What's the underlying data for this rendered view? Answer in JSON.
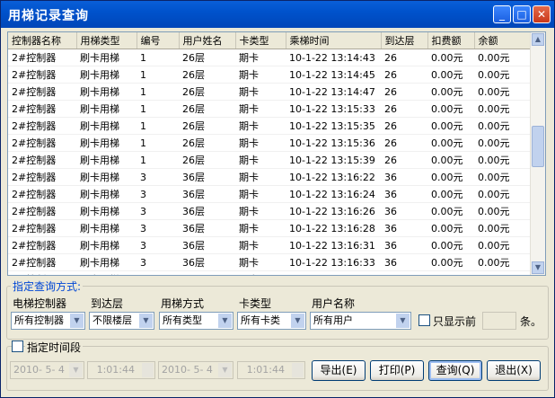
{
  "window": {
    "title": "用梯记录查询",
    "buttons": {
      "minimize": "_",
      "maximize": "□",
      "close": "✕"
    }
  },
  "table": {
    "columns": [
      "控制器名称",
      "用梯类型",
      "编号",
      "用户姓名",
      "卡类型",
      "乘梯时间",
      "到达层",
      "扣费额",
      "余额"
    ],
    "rows": [
      [
        "2#控制器",
        "刷卡用梯",
        "1",
        "26层",
        "期卡",
        "10-1-22 13:14:43",
        "26",
        "0.00元",
        "0.00元"
      ],
      [
        "2#控制器",
        "刷卡用梯",
        "1",
        "26层",
        "期卡",
        "10-1-22 13:14:45",
        "26",
        "0.00元",
        "0.00元"
      ],
      [
        "2#控制器",
        "刷卡用梯",
        "1",
        "26层",
        "期卡",
        "10-1-22 13:14:47",
        "26",
        "0.00元",
        "0.00元"
      ],
      [
        "2#控制器",
        "刷卡用梯",
        "1",
        "26层",
        "期卡",
        "10-1-22 13:15:33",
        "26",
        "0.00元",
        "0.00元"
      ],
      [
        "2#控制器",
        "刷卡用梯",
        "1",
        "26层",
        "期卡",
        "10-1-22 13:15:35",
        "26",
        "0.00元",
        "0.00元"
      ],
      [
        "2#控制器",
        "刷卡用梯",
        "1",
        "26层",
        "期卡",
        "10-1-22 13:15:36",
        "26",
        "0.00元",
        "0.00元"
      ],
      [
        "2#控制器",
        "刷卡用梯",
        "1",
        "26层",
        "期卡",
        "10-1-22 13:15:39",
        "26",
        "0.00元",
        "0.00元"
      ],
      [
        "2#控制器",
        "刷卡用梯",
        "3",
        "36层",
        "期卡",
        "10-1-22 13:16:22",
        "36",
        "0.00元",
        "0.00元"
      ],
      [
        "2#控制器",
        "刷卡用梯",
        "3",
        "36层",
        "期卡",
        "10-1-22 13:16:24",
        "36",
        "0.00元",
        "0.00元"
      ],
      [
        "2#控制器",
        "刷卡用梯",
        "3",
        "36层",
        "期卡",
        "10-1-22 13:16:26",
        "36",
        "0.00元",
        "0.00元"
      ],
      [
        "2#控制器",
        "刷卡用梯",
        "3",
        "36层",
        "期卡",
        "10-1-22 13:16:28",
        "36",
        "0.00元",
        "0.00元"
      ],
      [
        "2#控制器",
        "刷卡用梯",
        "3",
        "36层",
        "期卡",
        "10-1-22 13:16:31",
        "36",
        "0.00元",
        "0.00元"
      ],
      [
        "2#控制器",
        "刷卡用梯",
        "3",
        "36层",
        "期卡",
        "10-1-22 13:16:33",
        "36",
        "0.00元",
        "0.00元"
      ],
      [
        "2#控制器",
        "刷卡用梯",
        "3",
        "36层",
        "期卡",
        "10-1-22 13:16:35",
        "36",
        "0.00元",
        "0.00元"
      ]
    ]
  },
  "query": {
    "group_title": "指定查询方式:",
    "labels": {
      "controller": "电梯控制器",
      "floor": "到达层",
      "mode": "用梯方式",
      "card": "卡类型",
      "user": "用户名称"
    },
    "values": {
      "controller": "所有控制器",
      "floor": "不限楼层",
      "mode": "所有类型",
      "card": "所有卡类",
      "user": "所有用户"
    },
    "only_show_label": "只显示前",
    "count_unit": "条。"
  },
  "time": {
    "group_title": "指定时间段",
    "start_date": "2010- 5- 4",
    "start_time": "1:01:44",
    "end_date": "2010- 5- 4",
    "end_time": "1:01:44"
  },
  "actions": {
    "export": "导出(E)",
    "print": "打印(P)",
    "query": "查询(Q)",
    "exit": "退出(X)"
  },
  "icons": {
    "dropdown": "chevron-down-icon",
    "scroll_up": "arrow-up-icon",
    "scroll_down": "arrow-down-icon"
  }
}
